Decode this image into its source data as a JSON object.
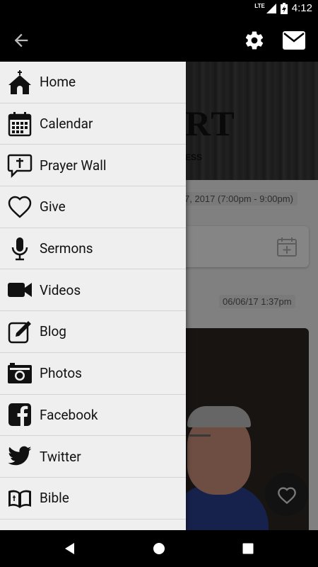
{
  "status": {
    "time": "4:12",
    "network": "LTE"
  },
  "appbar": {
    "back_icon": "arrow-back-icon",
    "settings_icon": "gear-icon",
    "mail_icon": "envelope-icon"
  },
  "background": {
    "hero_title": "RT",
    "hero_subtitle": "ESS",
    "event_date": "7, 2017 (7:00pm - 9:00pm)",
    "post_date": "06/06/17 1:37pm"
  },
  "drawer": {
    "items": [
      {
        "label": "Home",
        "icon": "church-icon"
      },
      {
        "label": "Calendar",
        "icon": "calendar-icon"
      },
      {
        "label": "Prayer Wall",
        "icon": "prayer-bubble-icon"
      },
      {
        "label": "Give",
        "icon": "heart-icon"
      },
      {
        "label": "Sermons",
        "icon": "microphone-icon"
      },
      {
        "label": "Videos",
        "icon": "video-camera-icon"
      },
      {
        "label": "Blog",
        "icon": "pencil-edit-icon"
      },
      {
        "label": "Photos",
        "icon": "camera-icon"
      },
      {
        "label": "Facebook",
        "icon": "facebook-icon"
      },
      {
        "label": "Twitter",
        "icon": "twitter-icon"
      },
      {
        "label": "Bible",
        "icon": "bible-icon"
      }
    ]
  },
  "colors": {
    "drawer_bg": "#efefef",
    "bar_bg": "#000000",
    "divider": "#d4d4d4"
  }
}
